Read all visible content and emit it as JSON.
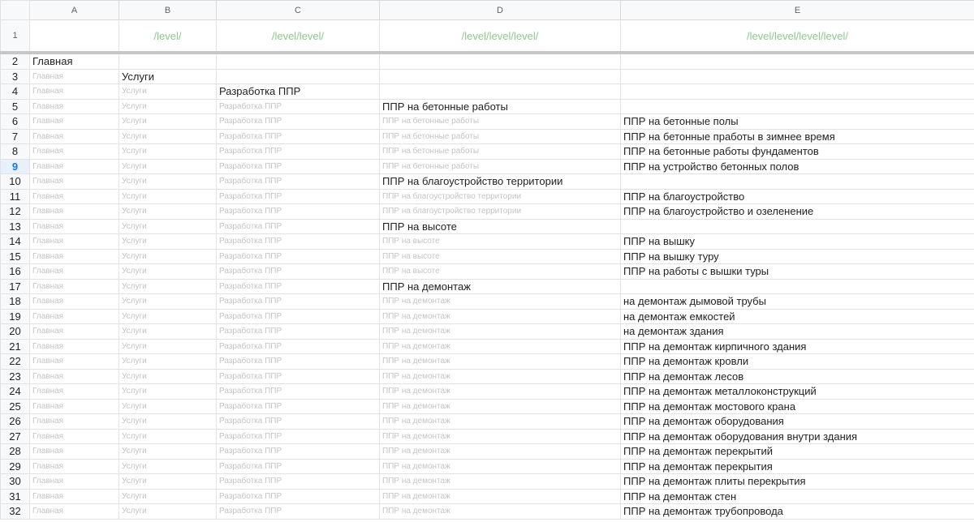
{
  "columns": [
    "A",
    "B",
    "C",
    "D",
    "E"
  ],
  "level_row": {
    "num": "1",
    "cells": [
      "",
      "/level/",
      "/level/level/",
      "/level/level/level/",
      "/level/level/level/level/"
    ]
  },
  "selected_row": "9",
  "rows": [
    {
      "num": "2",
      "cells": [
        {
          "t": "Главная",
          "g": false
        },
        {
          "t": "",
          "g": false
        },
        {
          "t": "",
          "g": false
        },
        {
          "t": "",
          "g": false
        },
        {
          "t": "",
          "g": false
        }
      ]
    },
    {
      "num": "3",
      "cells": [
        {
          "t": "Главная",
          "g": true
        },
        {
          "t": "Услуги",
          "g": false
        },
        {
          "t": "",
          "g": false
        },
        {
          "t": "",
          "g": false
        },
        {
          "t": "",
          "g": false
        }
      ]
    },
    {
      "num": "4",
      "cells": [
        {
          "t": "Главная",
          "g": true
        },
        {
          "t": "Услуги",
          "g": true
        },
        {
          "t": "Разработка ППР",
          "g": false
        },
        {
          "t": "",
          "g": false
        },
        {
          "t": "",
          "g": false
        }
      ]
    },
    {
      "num": "5",
      "cells": [
        {
          "t": "Главная",
          "g": true
        },
        {
          "t": "Услуги",
          "g": true
        },
        {
          "t": "Разработка ППР",
          "g": true
        },
        {
          "t": "ППР на бетонные работы",
          "g": false
        },
        {
          "t": "",
          "g": false
        }
      ]
    },
    {
      "num": "6",
      "cells": [
        {
          "t": "Главная",
          "g": true
        },
        {
          "t": "Услуги",
          "g": true
        },
        {
          "t": "Разработка ППР",
          "g": true
        },
        {
          "t": "ППР на бетонные работы",
          "g": true
        },
        {
          "t": "ППР на бетонные полы",
          "g": false
        }
      ]
    },
    {
      "num": "7",
      "cells": [
        {
          "t": "Главная",
          "g": true
        },
        {
          "t": "Услуги",
          "g": true
        },
        {
          "t": "Разработка ППР",
          "g": true
        },
        {
          "t": "ППР на бетонные работы",
          "g": true
        },
        {
          "t": "ППР на бетонные пработы в зимнее время",
          "g": false
        }
      ]
    },
    {
      "num": "8",
      "cells": [
        {
          "t": "Главная",
          "g": true
        },
        {
          "t": "Услуги",
          "g": true
        },
        {
          "t": "Разработка ППР",
          "g": true
        },
        {
          "t": "ППР на бетонные работы",
          "g": true
        },
        {
          "t": "ППР на бетонные работы фундаментов",
          "g": false
        }
      ]
    },
    {
      "num": "9",
      "cells": [
        {
          "t": "Главная",
          "g": true
        },
        {
          "t": "Услуги",
          "g": true
        },
        {
          "t": "Разработка ППР",
          "g": true
        },
        {
          "t": "ППР на бетонные работы",
          "g": true
        },
        {
          "t": "ППР на устройство бетонных полов",
          "g": false
        }
      ]
    },
    {
      "num": "10",
      "cells": [
        {
          "t": "Главная",
          "g": true
        },
        {
          "t": "Услуги",
          "g": true
        },
        {
          "t": "Разработка ППР",
          "g": true
        },
        {
          "t": "ППР на благоустройство территории",
          "g": false
        },
        {
          "t": "",
          "g": false
        }
      ]
    },
    {
      "num": "11",
      "cells": [
        {
          "t": "Главная",
          "g": true
        },
        {
          "t": "Услуги",
          "g": true
        },
        {
          "t": "Разработка ППР",
          "g": true
        },
        {
          "t": "ППР на благоустройство территории",
          "g": true
        },
        {
          "t": "ППР на благоустройство",
          "g": false
        }
      ]
    },
    {
      "num": "12",
      "cells": [
        {
          "t": "Главная",
          "g": true
        },
        {
          "t": "Услуги",
          "g": true
        },
        {
          "t": "Разработка ППР",
          "g": true
        },
        {
          "t": "ППР на благоустройство территории",
          "g": true
        },
        {
          "t": "ППР на благоустройство и озеленение",
          "g": false
        }
      ]
    },
    {
      "num": "13",
      "cells": [
        {
          "t": "Главная",
          "g": true
        },
        {
          "t": "Услуги",
          "g": true
        },
        {
          "t": "Разработка ППР",
          "g": true
        },
        {
          "t": "ППР на высоте",
          "g": false
        },
        {
          "t": "",
          "g": false
        }
      ]
    },
    {
      "num": "14",
      "cells": [
        {
          "t": "Главная",
          "g": true
        },
        {
          "t": "Услуги",
          "g": true
        },
        {
          "t": "Разработка ППР",
          "g": true
        },
        {
          "t": "ППР на высоте",
          "g": true
        },
        {
          "t": "ППР на вышку",
          "g": false
        }
      ]
    },
    {
      "num": "15",
      "cells": [
        {
          "t": "Главная",
          "g": true
        },
        {
          "t": "Услуги",
          "g": true
        },
        {
          "t": "Разработка ППР",
          "g": true
        },
        {
          "t": "ППР на высоте",
          "g": true
        },
        {
          "t": "ППР на вышку туру",
          "g": false
        }
      ]
    },
    {
      "num": "16",
      "cells": [
        {
          "t": "Главная",
          "g": true
        },
        {
          "t": "Услуги",
          "g": true
        },
        {
          "t": "Разработка ППР",
          "g": true
        },
        {
          "t": "ППР на высоте",
          "g": true
        },
        {
          "t": "ППР на работы с вышки туры",
          "g": false
        }
      ]
    },
    {
      "num": "17",
      "cells": [
        {
          "t": "Главная",
          "g": true
        },
        {
          "t": "Услуги",
          "g": true
        },
        {
          "t": "Разработка ППР",
          "g": true
        },
        {
          "t": "ППР на демонтаж",
          "g": false
        },
        {
          "t": "",
          "g": false
        }
      ]
    },
    {
      "num": "18",
      "cells": [
        {
          "t": "Главная",
          "g": true
        },
        {
          "t": "Услуги",
          "g": true
        },
        {
          "t": "Разработка ППР",
          "g": true
        },
        {
          "t": "ППР на демонтаж",
          "g": true
        },
        {
          "t": "на демонтаж дымовой трубы",
          "g": false
        }
      ]
    },
    {
      "num": "19",
      "cells": [
        {
          "t": "Главная",
          "g": true
        },
        {
          "t": "Услуги",
          "g": true
        },
        {
          "t": "Разработка ППР",
          "g": true
        },
        {
          "t": "ППР на демонтаж",
          "g": true
        },
        {
          "t": "на демонтаж емкостей",
          "g": false
        }
      ]
    },
    {
      "num": "20",
      "cells": [
        {
          "t": "Главная",
          "g": true
        },
        {
          "t": "Услуги",
          "g": true
        },
        {
          "t": "Разработка ППР",
          "g": true
        },
        {
          "t": "ППР на демонтаж",
          "g": true
        },
        {
          "t": "на демонтаж здания",
          "g": false
        }
      ]
    },
    {
      "num": "21",
      "cells": [
        {
          "t": "Главная",
          "g": true
        },
        {
          "t": "Услуги",
          "g": true
        },
        {
          "t": "Разработка ППР",
          "g": true
        },
        {
          "t": "ППР на демонтаж",
          "g": true
        },
        {
          "t": "ППР на демонтаж кирпичного здания",
          "g": false
        }
      ]
    },
    {
      "num": "22",
      "cells": [
        {
          "t": "Главная",
          "g": true
        },
        {
          "t": "Услуги",
          "g": true
        },
        {
          "t": "Разработка ППР",
          "g": true
        },
        {
          "t": "ППР на демонтаж",
          "g": true
        },
        {
          "t": "ППР на демонтаж кровли",
          "g": false
        }
      ]
    },
    {
      "num": "23",
      "cells": [
        {
          "t": "Главная",
          "g": true
        },
        {
          "t": "Услуги",
          "g": true
        },
        {
          "t": "Разработка ППР",
          "g": true
        },
        {
          "t": "ППР на демонтаж",
          "g": true
        },
        {
          "t": "ППР на демонтаж лесов",
          "g": false
        }
      ]
    },
    {
      "num": "24",
      "cells": [
        {
          "t": "Главная",
          "g": true
        },
        {
          "t": "Услуги",
          "g": true
        },
        {
          "t": "Разработка ППР",
          "g": true
        },
        {
          "t": "ППР на демонтаж",
          "g": true
        },
        {
          "t": "ППР на демонтаж металлоконструкций",
          "g": false
        }
      ]
    },
    {
      "num": "25",
      "cells": [
        {
          "t": "Главная",
          "g": true
        },
        {
          "t": "Услуги",
          "g": true
        },
        {
          "t": "Разработка ППР",
          "g": true
        },
        {
          "t": "ППР на демонтаж",
          "g": true
        },
        {
          "t": "ППР на демонтаж мостового крана",
          "g": false
        }
      ]
    },
    {
      "num": "26",
      "cells": [
        {
          "t": "Главная",
          "g": true
        },
        {
          "t": "Услуги",
          "g": true
        },
        {
          "t": "Разработка ППР",
          "g": true
        },
        {
          "t": "ППР на демонтаж",
          "g": true
        },
        {
          "t": "ППР на демонтаж оборудования",
          "g": false
        }
      ]
    },
    {
      "num": "27",
      "cells": [
        {
          "t": "Главная",
          "g": true
        },
        {
          "t": "Услуги",
          "g": true
        },
        {
          "t": "Разработка ППР",
          "g": true
        },
        {
          "t": "ППР на демонтаж",
          "g": true
        },
        {
          "t": "ППР на демонтаж оборудования внутри здания",
          "g": false
        }
      ]
    },
    {
      "num": "28",
      "cells": [
        {
          "t": "Главная",
          "g": true
        },
        {
          "t": "Услуги",
          "g": true
        },
        {
          "t": "Разработка ППР",
          "g": true
        },
        {
          "t": "ППР на демонтаж",
          "g": true
        },
        {
          "t": "ППР на демонтаж перекрытий",
          "g": false
        }
      ]
    },
    {
      "num": "29",
      "cells": [
        {
          "t": "Главная",
          "g": true
        },
        {
          "t": "Услуги",
          "g": true
        },
        {
          "t": "Разработка ППР",
          "g": true
        },
        {
          "t": "ППР на демонтаж",
          "g": true
        },
        {
          "t": "ППР на демонтаж перекрытия",
          "g": false
        }
      ]
    },
    {
      "num": "30",
      "cells": [
        {
          "t": "Главная",
          "g": true
        },
        {
          "t": "Услуги",
          "g": true
        },
        {
          "t": "Разработка ППР",
          "g": true
        },
        {
          "t": "ППР на демонтаж",
          "g": true
        },
        {
          "t": "ППР на демонтаж плиты перекрытия",
          "g": false
        }
      ]
    },
    {
      "num": "31",
      "cells": [
        {
          "t": "Главная",
          "g": true
        },
        {
          "t": "Услуги",
          "g": true
        },
        {
          "t": "Разработка ППР",
          "g": true
        },
        {
          "t": "ППР на демонтаж",
          "g": true
        },
        {
          "t": "ППР на демонтаж стен",
          "g": false
        }
      ]
    },
    {
      "num": "32",
      "cells": [
        {
          "t": "Главная",
          "g": true
        },
        {
          "t": "Услуги",
          "g": true
        },
        {
          "t": "Разработка ППР",
          "g": true
        },
        {
          "t": "ППР на демонтаж",
          "g": true
        },
        {
          "t": "ППР на демонтаж трубопровода",
          "g": false
        }
      ]
    }
  ]
}
